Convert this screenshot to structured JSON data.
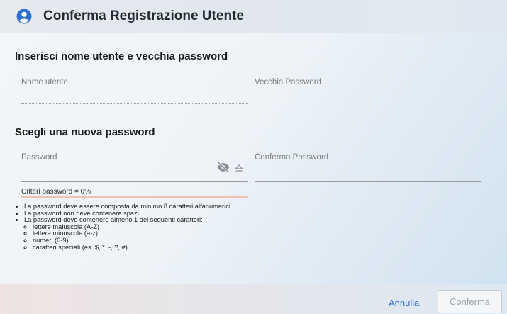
{
  "dialog": {
    "title": "Conferma Registrazione Utente",
    "accent_color": "#2f6fd0"
  },
  "section_old": {
    "title": "Inserisci nome utente e vecchia password",
    "username_label": "Nome utente",
    "old_password_label": "Vecchia Password"
  },
  "section_new": {
    "title": "Scegli una nuova password",
    "password_label": "Password",
    "confirm_password_label": "Conferma Password"
  },
  "criteria": {
    "label": "Criteri password = 0%",
    "progress_percent": 0,
    "bar_color": "#e1541f"
  },
  "rules": {
    "items": [
      "La password deve essere composta da minimo 8 caratteri alfanumerici.",
      "La password non deve contenere spazi.",
      "La password deve contenere almeno 1 dei seguenti caratteri:"
    ],
    "sub_items": [
      "lettere maiuscola (A-Z)",
      "lettere minuscole (a-z)",
      "numeri (0-9)",
      "caratteri speciali (es. $, *, -, ?, #)"
    ]
  },
  "actions": {
    "cancel_label": "Annulla",
    "confirm_label": "Conferma"
  },
  "icons": {
    "header": "user-circle-icon",
    "visibility": "eye-off-icon",
    "clear": "eject-icon"
  }
}
